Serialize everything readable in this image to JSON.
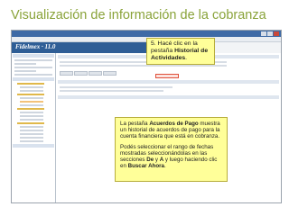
{
  "slide": {
    "title": "Visualización de información de la cobranza"
  },
  "app": {
    "brand": "Fidelmex · 11.0"
  },
  "callout_top": {
    "prefix": "5. Hacé clic en la pestaña ",
    "bold": "Historial de Actividades",
    "suffix": "."
  },
  "callout_main": {
    "p1_pre": "La pestaña ",
    "p1_bold": "Acuerdos de Pago",
    "p1_post": " muestra un historial de acuerdos de pago para la cuenta financiera que está en cobranza.",
    "p2_pre": "Podés seleccionar el rango de fechas mostradas seleccionándolas en las secciones ",
    "p2_bold1": "De",
    "p2_mid1": " y ",
    "p2_bold2": "A",
    "p2_mid2": " y luego haciendo clic en ",
    "p2_bold3": "Buscar Ahora",
    "p2_post": "."
  }
}
